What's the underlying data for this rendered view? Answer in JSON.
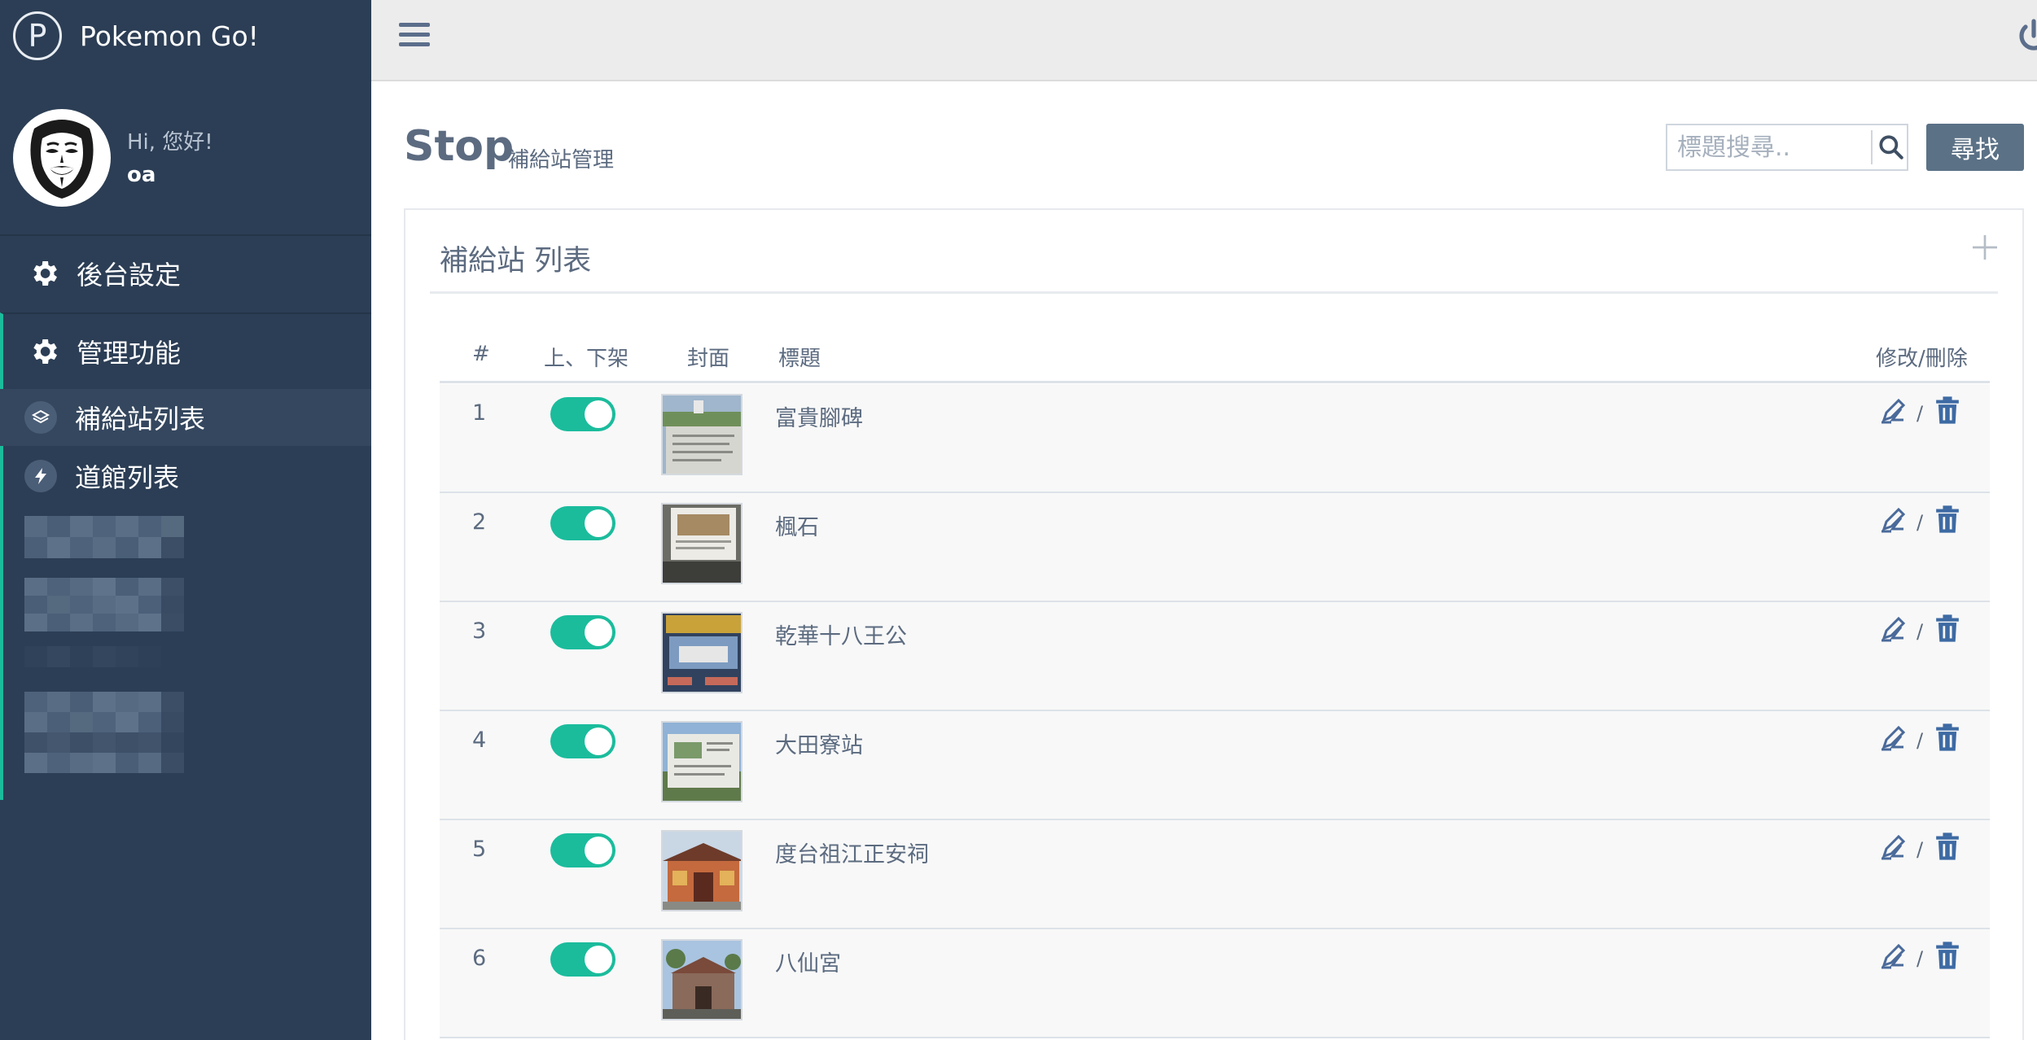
{
  "brand": {
    "logo_letter": "P",
    "name": "Pokemon Go!"
  },
  "profile": {
    "greeting": "Hi, 您好!",
    "username": "oa"
  },
  "nav": {
    "sections": [
      {
        "label": "後台設定",
        "icon": "gear-icon"
      },
      {
        "label": "管理功能",
        "icon": "gear-icon"
      }
    ],
    "subitems": [
      {
        "label": "補給站列表",
        "icon": "layers-icon"
      },
      {
        "label": "道館列表",
        "icon": "bolt-icon"
      }
    ]
  },
  "page": {
    "title": "Stop",
    "subtitle": "補給站管理"
  },
  "search": {
    "placeholder": "標題搜尋..",
    "button_label": "尋找"
  },
  "panel": {
    "title": "補給站 列表"
  },
  "table": {
    "headers": {
      "index": "#",
      "status": "上、下架",
      "cover": "封面",
      "title": "標題",
      "actions": "修改/刪除"
    },
    "action_separator": "/",
    "rows": [
      {
        "index": "1",
        "title": "富貴腳碑",
        "published": true
      },
      {
        "index": "2",
        "title": "楓石",
        "published": true
      },
      {
        "index": "3",
        "title": "乾華十八王公",
        "published": true
      },
      {
        "index": "4",
        "title": "大田寮站",
        "published": true
      },
      {
        "index": "5",
        "title": "度台祖江正安祠",
        "published": true
      },
      {
        "index": "6",
        "title": "八仙宮",
        "published": true
      }
    ]
  },
  "colors": {
    "sidebar": "#2c3e55",
    "accent": "#1abc9c",
    "text": "#5c6b80",
    "button": "#5b7186"
  }
}
